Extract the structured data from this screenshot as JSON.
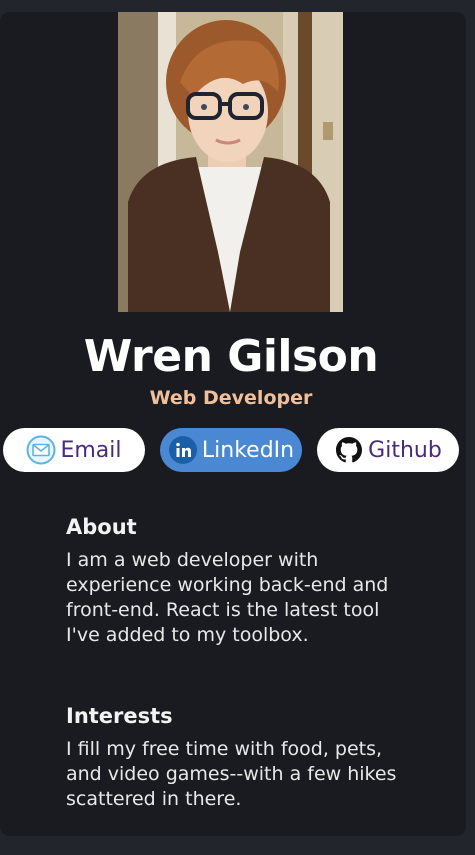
{
  "profile": {
    "name": "Wren Gilson",
    "role": "Web Developer"
  },
  "links": {
    "email_label": "Email",
    "linkedin_label": "LinkedIn",
    "github_label": "Github"
  },
  "about": {
    "title": "About",
    "text": "I am a web developer with experience working back-end and front-end. React is the latest tool I've added to my toolbox."
  },
  "interests": {
    "title": "Interests",
    "text": "I fill my free time with food, pets, and video games--with a few hikes scattered in there."
  },
  "colors": {
    "page_bg": "#23252c",
    "card_bg": "#1a1b21",
    "accent": "#f3bf99",
    "linkedin_blue": "#4a88d4",
    "button_text": "#4a2a7a"
  },
  "icons": [
    "envelope-icon",
    "linkedin-icon",
    "github-icon"
  ]
}
